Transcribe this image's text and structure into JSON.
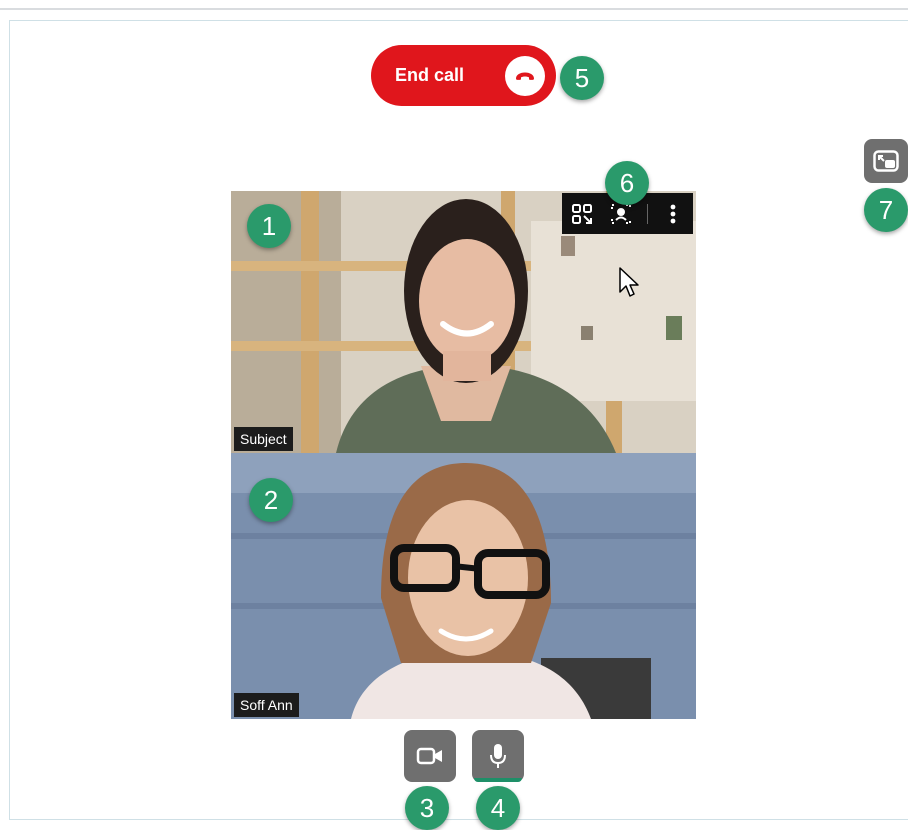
{
  "call": {
    "end_call_label": "End call",
    "end_call_color": "#e0161c"
  },
  "participants": [
    {
      "name": "Subject",
      "badge": "1"
    },
    {
      "name": "Soff Ann",
      "badge": "2"
    }
  ],
  "controls": {
    "camera_badge": "3",
    "mic_badge": "4",
    "mic_active_color": "#1e8f68"
  },
  "annotations": {
    "end_call_badge": "5",
    "video_toolbar_badge": "6",
    "pip_badge": "7",
    "badge_color": "#2a9a6b"
  },
  "video_toolbar": {
    "icons": [
      "layout-icon",
      "focus-icon",
      "more-vertical-icon"
    ]
  },
  "icons": {
    "end_call": "phone-hangup-icon",
    "pip": "picture-in-picture-icon",
    "camera": "video-camera-icon",
    "mic": "microphone-icon"
  }
}
